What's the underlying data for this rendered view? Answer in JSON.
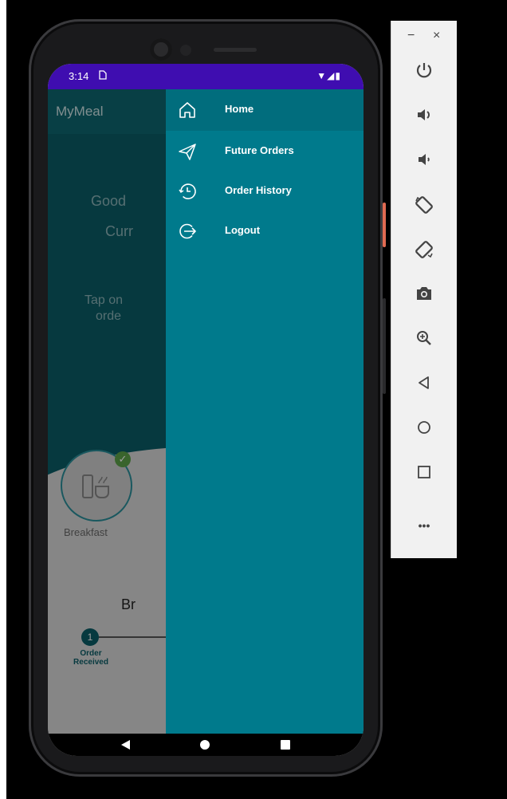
{
  "statusbar": {
    "time": "3:14",
    "sim_icon": "sim-card-icon",
    "right_icons": "▼◢▮"
  },
  "app": {
    "title": "MyMeal",
    "greeting": "Good",
    "current": "Curr",
    "tap_line1": "Tap on",
    "tap_line2": "orde",
    "meal_label": "Breakfast",
    "section_title": "Br",
    "step_number": "1",
    "step_label": "Order Received"
  },
  "drawer": {
    "items": [
      {
        "label": "Home",
        "icon": "home-icon"
      },
      {
        "label": "Future Orders",
        "icon": "paper-plane-icon"
      },
      {
        "label": "Order History",
        "icon": "history-clock-icon"
      },
      {
        "label": "Logout",
        "icon": "logout-icon"
      }
    ]
  },
  "emulator_panel": {
    "minimize": "−",
    "close": "×",
    "more": "•••"
  },
  "colors": {
    "statusbar": "#3f0db0",
    "appbar": "#0d6670",
    "drawer": "#007a8c",
    "drawer_active": "#016d7d",
    "check": "#5da24a"
  }
}
